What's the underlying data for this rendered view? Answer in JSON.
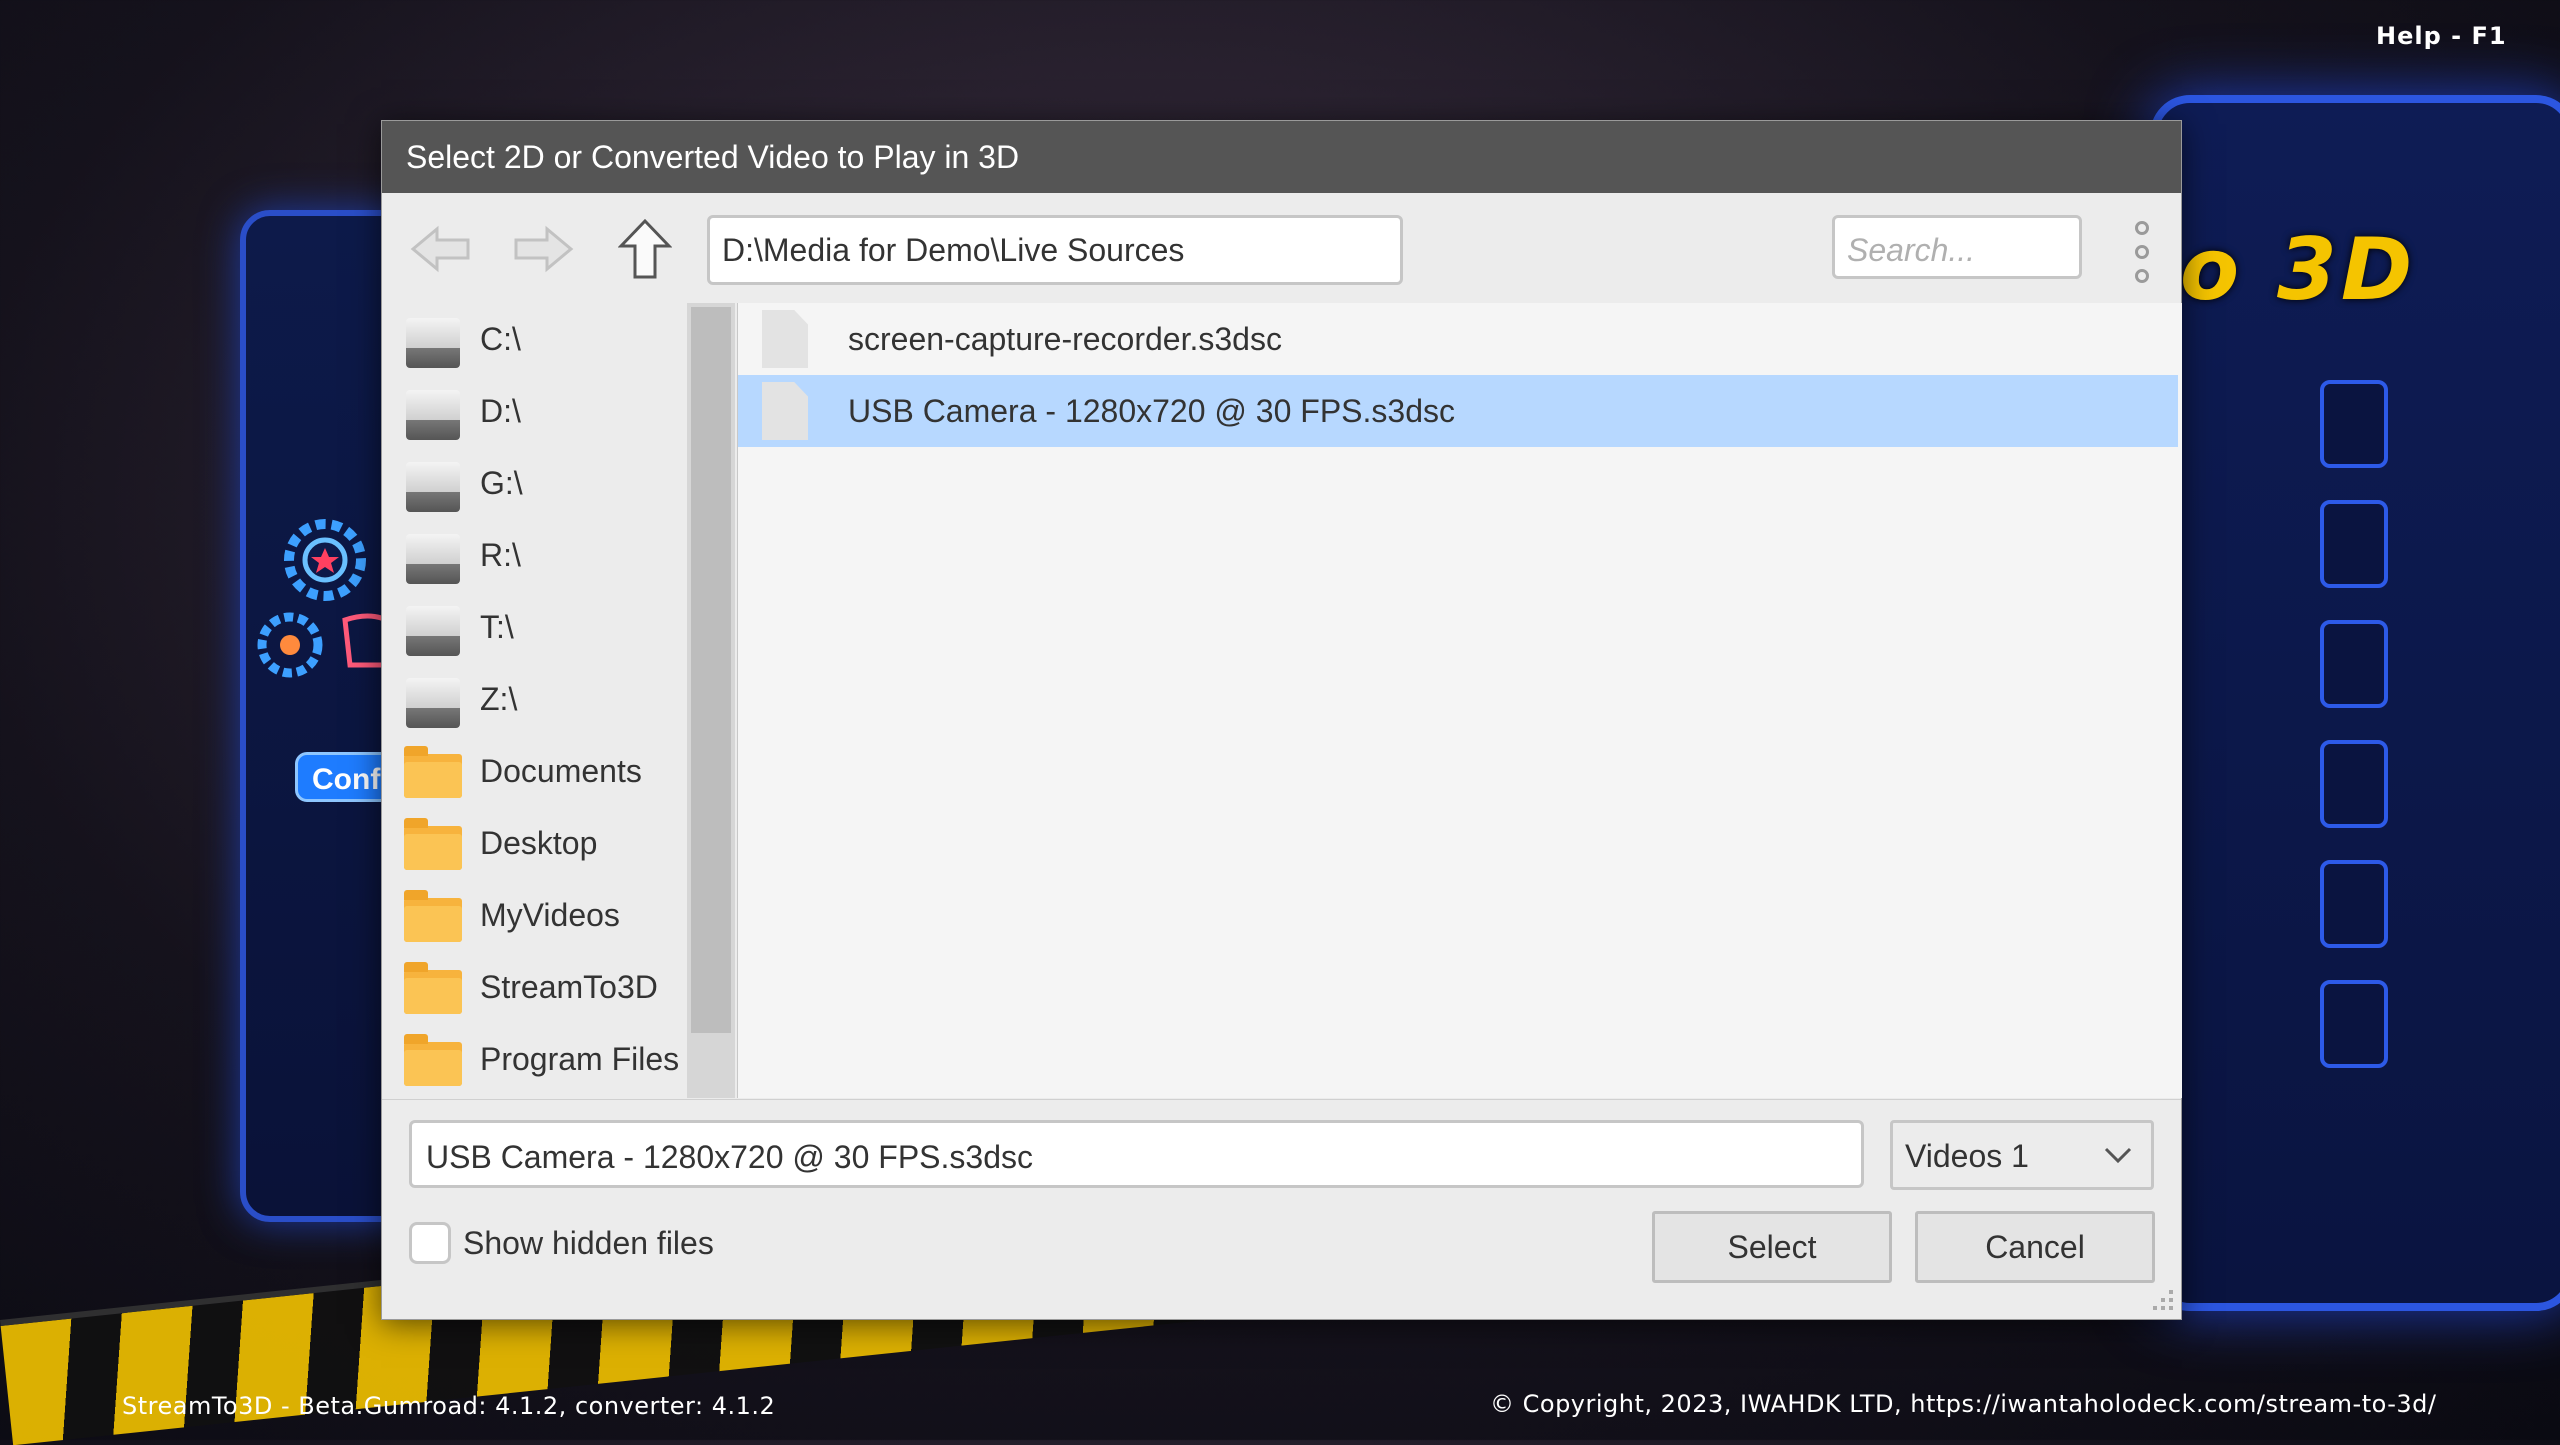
{
  "background": {
    "logo_text": "o 3D",
    "config_label": "Conf",
    "help_label": "Help - F1",
    "footer_left": "StreamTo3D - Beta.Gumroad: 4.1.2, converter: 4.1.2",
    "footer_right": "© Copyright, 2023, IWAHDK LTD, https://iwantaholodeck.com/stream-to-3d/"
  },
  "dialog": {
    "title": "Select 2D or Converted Video to Play in 3D",
    "toolbar": {
      "back_icon": "arrow-left-icon",
      "forward_icon": "arrow-right-icon",
      "up_icon": "arrow-up-icon",
      "path": "D:\\Media for Demo\\Live Sources",
      "search_placeholder": "Search...",
      "more_icon": "vertical-dots-icon"
    },
    "sidebar": {
      "items": [
        {
          "label": "C:\\",
          "icon": "drive-icon"
        },
        {
          "label": "D:\\",
          "icon": "drive-icon"
        },
        {
          "label": "G:\\",
          "icon": "drive-icon"
        },
        {
          "label": "R:\\",
          "icon": "drive-icon"
        },
        {
          "label": "T:\\",
          "icon": "drive-icon"
        },
        {
          "label": "Z:\\",
          "icon": "drive-icon"
        },
        {
          "label": "Documents",
          "icon": "folder-icon"
        },
        {
          "label": "Desktop",
          "icon": "folder-icon"
        },
        {
          "label": "MyVideos",
          "icon": "folder-icon"
        },
        {
          "label": "StreamTo3D",
          "icon": "folder-icon"
        },
        {
          "label": "Program Files",
          "icon": "folder-icon"
        }
      ]
    },
    "files": [
      {
        "name": "screen-capture-recorder.s3dsc",
        "selected": false
      },
      {
        "name": "USB Camera - 1280x720 @ 30 FPS.s3dsc",
        "selected": true
      }
    ],
    "filename": "USB Camera - 1280x720 @ 30 FPS.s3dsc",
    "filter": "Videos 1",
    "show_hidden_label": "Show hidden files",
    "show_hidden_checked": false,
    "select_label": "Select",
    "cancel_label": "Cancel"
  },
  "colors": {
    "selection": "#b7d8ff",
    "titlebar": "#555555",
    "folder": "#f7b33d",
    "accent_blue": "#2c56e0",
    "logo_yellow": "#f5c400"
  }
}
